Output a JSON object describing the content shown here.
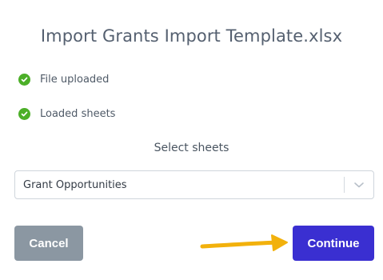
{
  "dialog": {
    "title": "Import Grants Import Template.xlsx",
    "statuses": [
      {
        "label": "File uploaded",
        "icon": "check-circle-icon",
        "color": "#4caf28"
      },
      {
        "label": "Loaded sheets",
        "icon": "check-circle-icon",
        "color": "#4caf28"
      }
    ],
    "select_heading": "Select sheets",
    "sheet_select": {
      "value": "Grant Opportunities",
      "icon": "chevron-down-icon"
    },
    "buttons": {
      "cancel_label": "Cancel",
      "continue_label": "Continue"
    },
    "colors": {
      "cancel_bg": "#8b97a2",
      "continue_bg": "#3a2fd1",
      "annotation_arrow": "#f2b10c"
    }
  }
}
